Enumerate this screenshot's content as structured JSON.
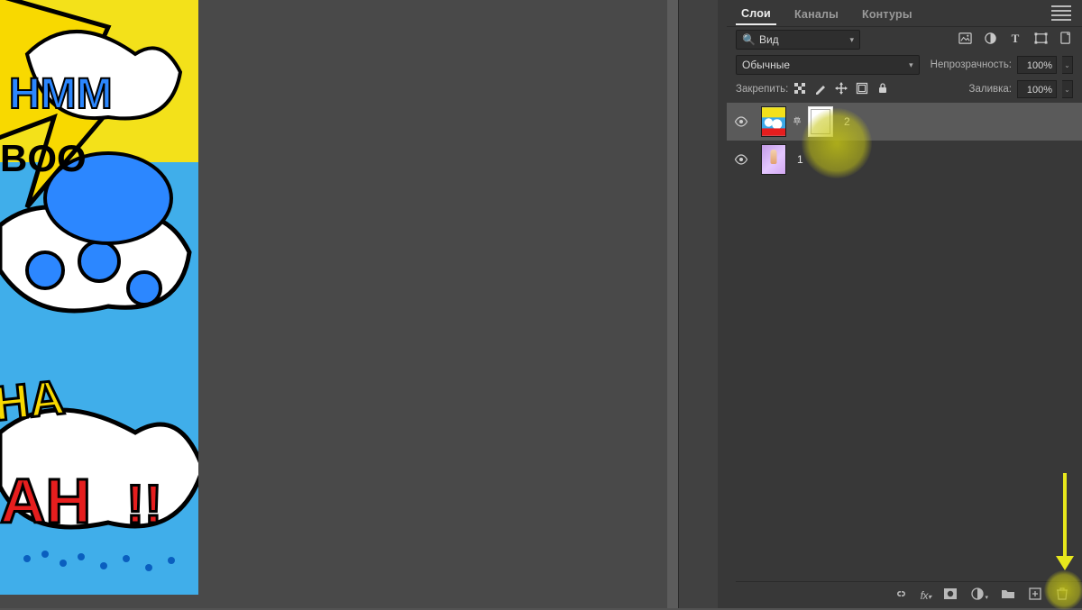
{
  "tabs": {
    "layers": "Слои",
    "channels": "Каналы",
    "paths": "Контуры"
  },
  "search": {
    "label": "Вид"
  },
  "blend": {
    "mode": "Обычные",
    "opacity_label": "Непрозрачность:",
    "opacity": "100%"
  },
  "lock": {
    "label": "Закрепить:",
    "fill_label": "Заливка:",
    "fill": "100%"
  },
  "layers": [
    {
      "name": "2",
      "has_mask": true,
      "selected": true
    },
    {
      "name": "1",
      "has_mask": false,
      "selected": false
    }
  ],
  "icons": {
    "image": "image-icon",
    "adjust": "adjustment-icon",
    "type": "type-icon",
    "shape": "shape-icon",
    "smart": "smartobj-icon",
    "lock_trans": "lock-transparency-icon",
    "lock_pix": "lock-pixels-icon",
    "lock_pos": "lock-position-icon",
    "lock_art": "lock-artboard-icon",
    "lock_all": "lock-all-icon",
    "link": "link-icon",
    "fx": "fx-icon",
    "mask": "mask-icon",
    "newadj": "new-adj-icon",
    "group": "group-icon",
    "newlayer": "new-layer-icon",
    "trash": "trash-icon"
  }
}
